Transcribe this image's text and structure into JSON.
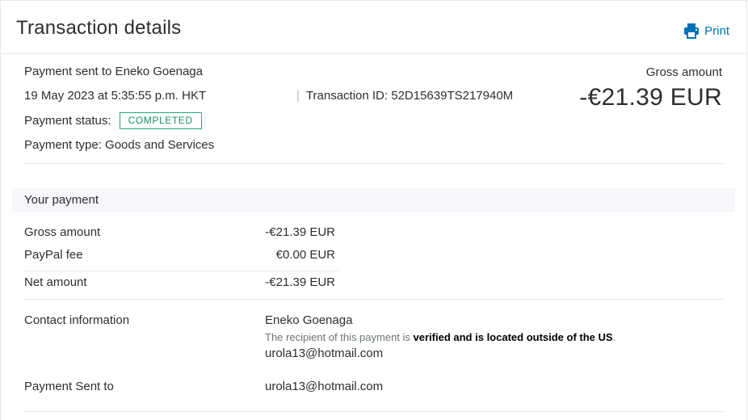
{
  "header": {
    "title": "Transaction details",
    "print_label": "Print",
    "print_icon": "printer-icon",
    "accent_color": "#0070ba"
  },
  "summary": {
    "sent_to": "Payment sent to Eneko Goenaga",
    "datetime": "19 May 2023 at 5:35:55 p.m. HKT",
    "status_label": "Payment status:",
    "status_badge": "COMPLETED",
    "status_color": "#1a8e66",
    "type": "Payment type: Goods and Services",
    "transaction_id": "Transaction ID: 52D15639TS217940M",
    "gross_label": "Gross amount",
    "gross_value": "-€21.39 EUR"
  },
  "your_payment": {
    "section_title": "Your payment",
    "rows": [
      {
        "label": "Gross amount",
        "value": "-€21.39 EUR"
      },
      {
        "label": "PayPal fee",
        "value": "€0.00 EUR"
      },
      {
        "label": "Net amount",
        "value": "-€21.39 EUR"
      }
    ]
  },
  "contact": {
    "label": "Contact information",
    "name": "Eneko Goenaga",
    "note_prefix": "The recipient of this payment is ",
    "note_bold": "verified and is located outside of the US",
    "note_suffix": ".",
    "email": "urola13@hotmail.com"
  },
  "payment_sent_to": {
    "label": "Payment Sent to",
    "value": "urola13@hotmail.com"
  }
}
